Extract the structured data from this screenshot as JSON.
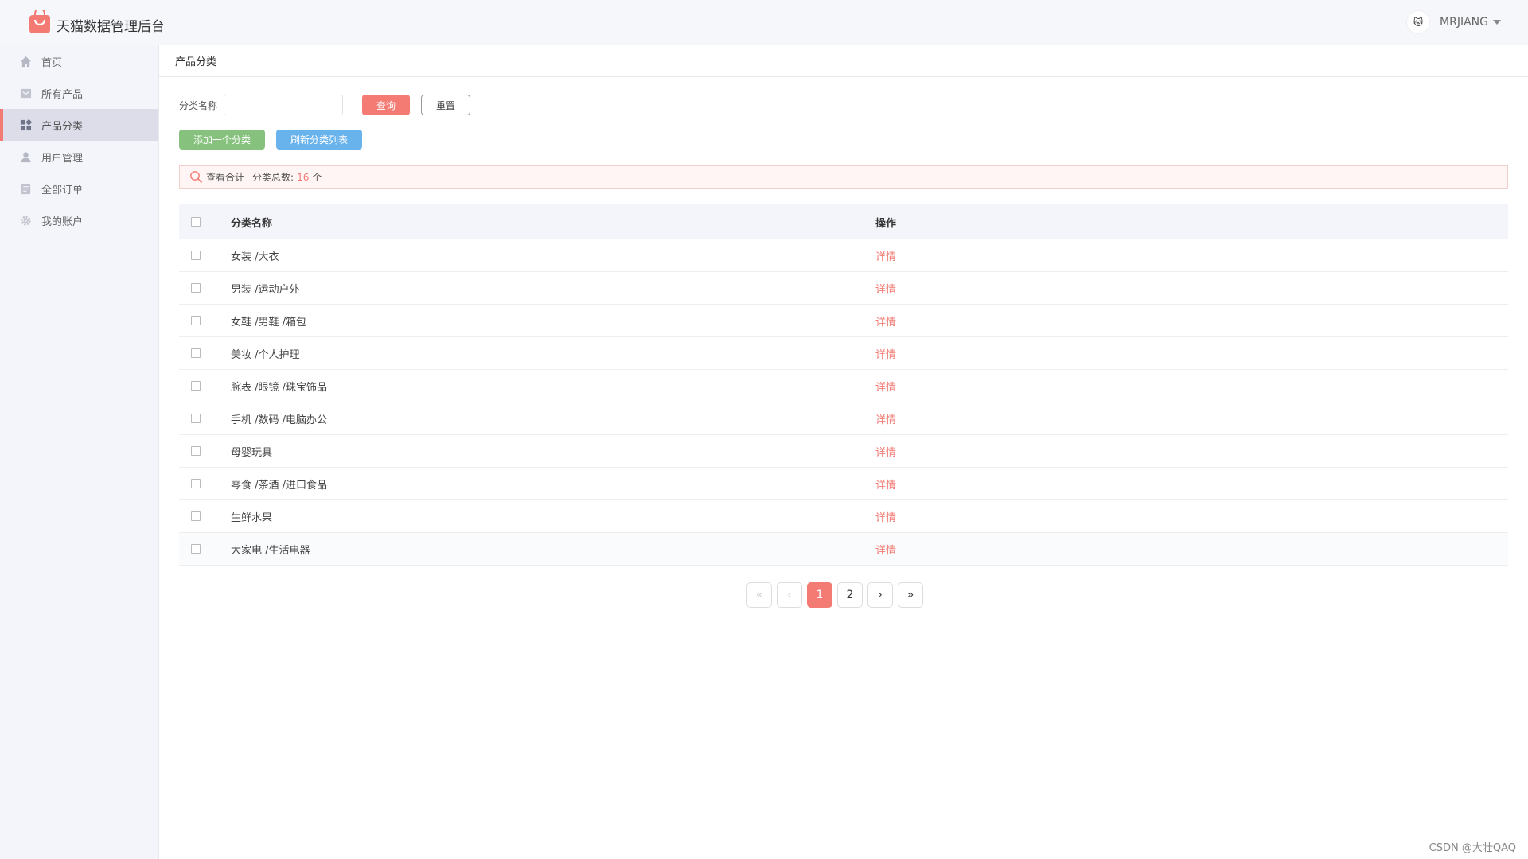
{
  "app": {
    "title": "天猫数据管理后台"
  },
  "user": {
    "name": "MRJIANG",
    "avatar_glyph": "🐱"
  },
  "sidebar": {
    "items": [
      {
        "label": "首页",
        "icon": "home-icon",
        "active": false
      },
      {
        "label": "所有产品",
        "icon": "product-icon",
        "active": false
      },
      {
        "label": "产品分类",
        "icon": "category-icon",
        "active": true
      },
      {
        "label": "用户管理",
        "icon": "user-icon",
        "active": false
      },
      {
        "label": "全部订单",
        "icon": "order-icon",
        "active": false
      },
      {
        "label": "我的账户",
        "icon": "gear-icon",
        "active": false
      }
    ]
  },
  "breadcrumb": "产品分类",
  "search": {
    "label": "分类名称",
    "value": "",
    "placeholder": ""
  },
  "buttons": {
    "query": "查询",
    "reset": "重置",
    "add": "添加一个分类",
    "refresh": "刷新分类列表"
  },
  "summary": {
    "title": "查看合计",
    "count_label": "分类总数:",
    "count": "16",
    "unit": "个"
  },
  "table": {
    "columns": [
      "分类名称",
      "操作"
    ],
    "rows": [
      {
        "name": "女装 /大衣",
        "action": "详情"
      },
      {
        "name": "男装 /运动户外",
        "action": "详情"
      },
      {
        "name": "女鞋 /男鞋 /箱包",
        "action": "详情"
      },
      {
        "name": "美妆 /个人护理",
        "action": "详情"
      },
      {
        "name": "腕表 /眼镜 /珠宝饰品",
        "action": "详情"
      },
      {
        "name": "手机 /数码 /电脑办公",
        "action": "详情"
      },
      {
        "name": "母婴玩具",
        "action": "详情"
      },
      {
        "name": "零食 /茶酒 /进口食品",
        "action": "详情"
      },
      {
        "name": "生鲜水果",
        "action": "详情"
      },
      {
        "name": "大家电 /生活电器",
        "action": "详情"
      }
    ]
  },
  "pagination": {
    "first": "«",
    "prev": "‹",
    "pages": [
      "1",
      "2"
    ],
    "current": "1",
    "next": "›",
    "last": "»"
  },
  "watermark": "CSDN @大壮QAQ",
  "colors": {
    "accent": "#f37b74",
    "green": "#86c27d",
    "blue": "#69b3ec",
    "sidebar_bg": "#f4f5fa"
  }
}
